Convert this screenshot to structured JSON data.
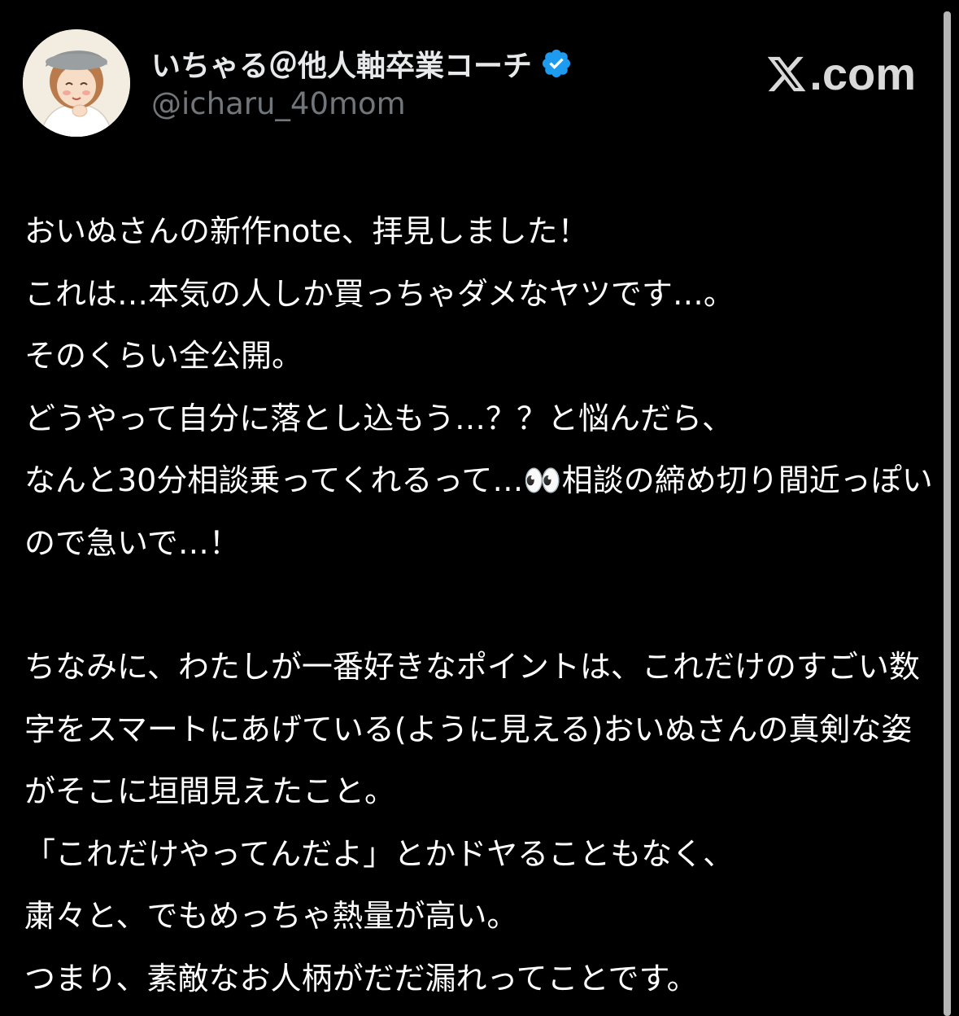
{
  "author": {
    "display_name": "いちゃる＠他人軸卒業コーチ",
    "handle": "@icharu_40mom",
    "verified": true,
    "verified_color": "#1d9bf0"
  },
  "brand": {
    "label": ".com",
    "logo_icon": "x-logo-icon"
  },
  "tweet": {
    "paragraphs": [
      "おいぬさんの新作note、拝見しました！\nこれは…本気の人しか買っちゃダメなヤツです…。\nそのくらい全公開。\nどうやって自分に落とし込もう…？？と悩んだら、\nなんと30分相談乗ってくれるって…👀相談の締め切り間近っぽいので急いで…！",
      "ちなみに、わたしが一番好きなポイントは、これだけのすごい数字をスマートにあげている(ように見える)おいぬさんの真剣な姿がそこに垣間見えたこと。\n「これだけやってんだよ」とかドヤることもなく、\n粛々と、でもめっちゃ熱量が高い。\nつまり、素敵なお人柄がだだ漏れってことです。"
    ]
  },
  "colors": {
    "background": "#000000",
    "text": "#ffffff",
    "muted": "#71767b"
  }
}
